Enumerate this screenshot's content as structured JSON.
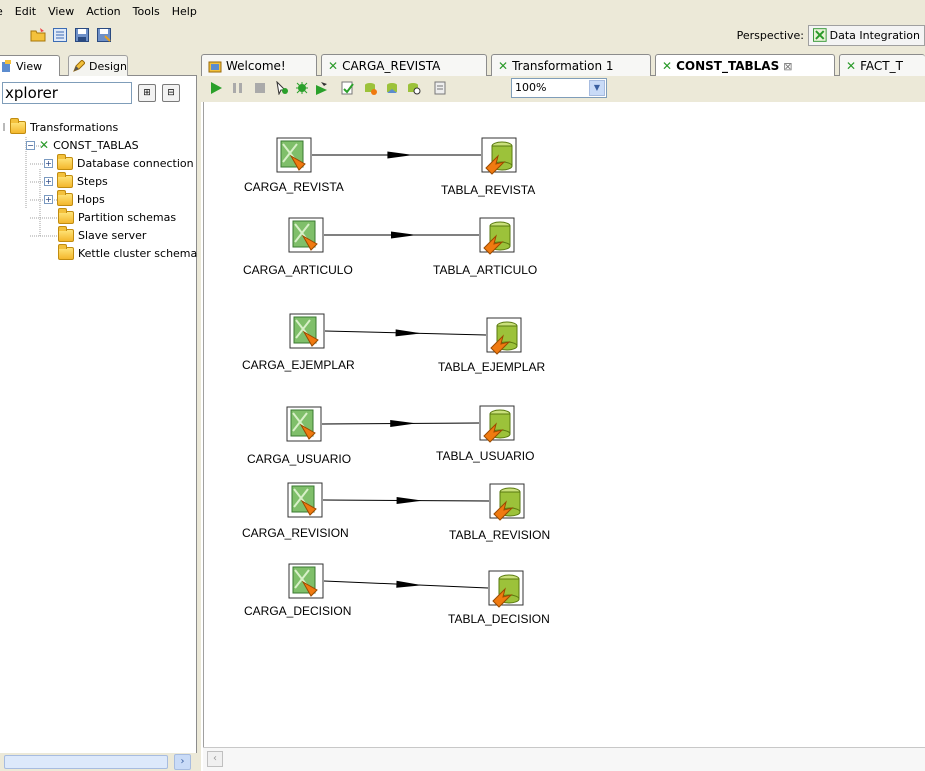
{
  "menu": [
    "e",
    "Edit",
    "View",
    "Action",
    "Tools",
    "Help"
  ],
  "perspective": {
    "label": "Perspective:",
    "value": "Data Integration"
  },
  "left_panel": {
    "tabs": [
      {
        "label": "View"
      },
      {
        "label": "Design"
      }
    ],
    "explorer_input": "xplorer",
    "tree": [
      {
        "label": "Transformations"
      },
      {
        "label": "CONST_TABLAS"
      },
      {
        "label": "Database connection"
      },
      {
        "label": "Steps"
      },
      {
        "label": "Hops"
      },
      {
        "label": "Partition schemas"
      },
      {
        "label": "Slave server"
      },
      {
        "label": "Kettle cluster schema"
      }
    ]
  },
  "tabs": [
    {
      "label": "Welcome!"
    },
    {
      "label": "CARGA_REVISTA"
    },
    {
      "label": "Transformation 1"
    },
    {
      "label": "CONST_TABLAS"
    },
    {
      "label": "FACT_T"
    }
  ],
  "zoom": "100%",
  "steps": [
    {
      "source": "CARGA_REVISTA",
      "target": "TABLA_REVISTA"
    },
    {
      "source": "CARGA_ARTICULO",
      "target": "TABLA_ARTICULO"
    },
    {
      "source": "CARGA_EJEMPLAR",
      "target": "TABLA_EJEMPLAR"
    },
    {
      "source": "CARGA_USUARIO",
      "target": "TABLA_USUARIO"
    },
    {
      "source": "CARGA_REVISION",
      "target": "TABLA_REVISION"
    },
    {
      "source": "CARGA_DECISION",
      "target": "TABLA_DECISION"
    }
  ],
  "colors": {
    "accent_green": "#2a9a2a",
    "hop_line": "#000000",
    "arrow_orange": "#f07a10",
    "db_green": "#9cc23a"
  }
}
